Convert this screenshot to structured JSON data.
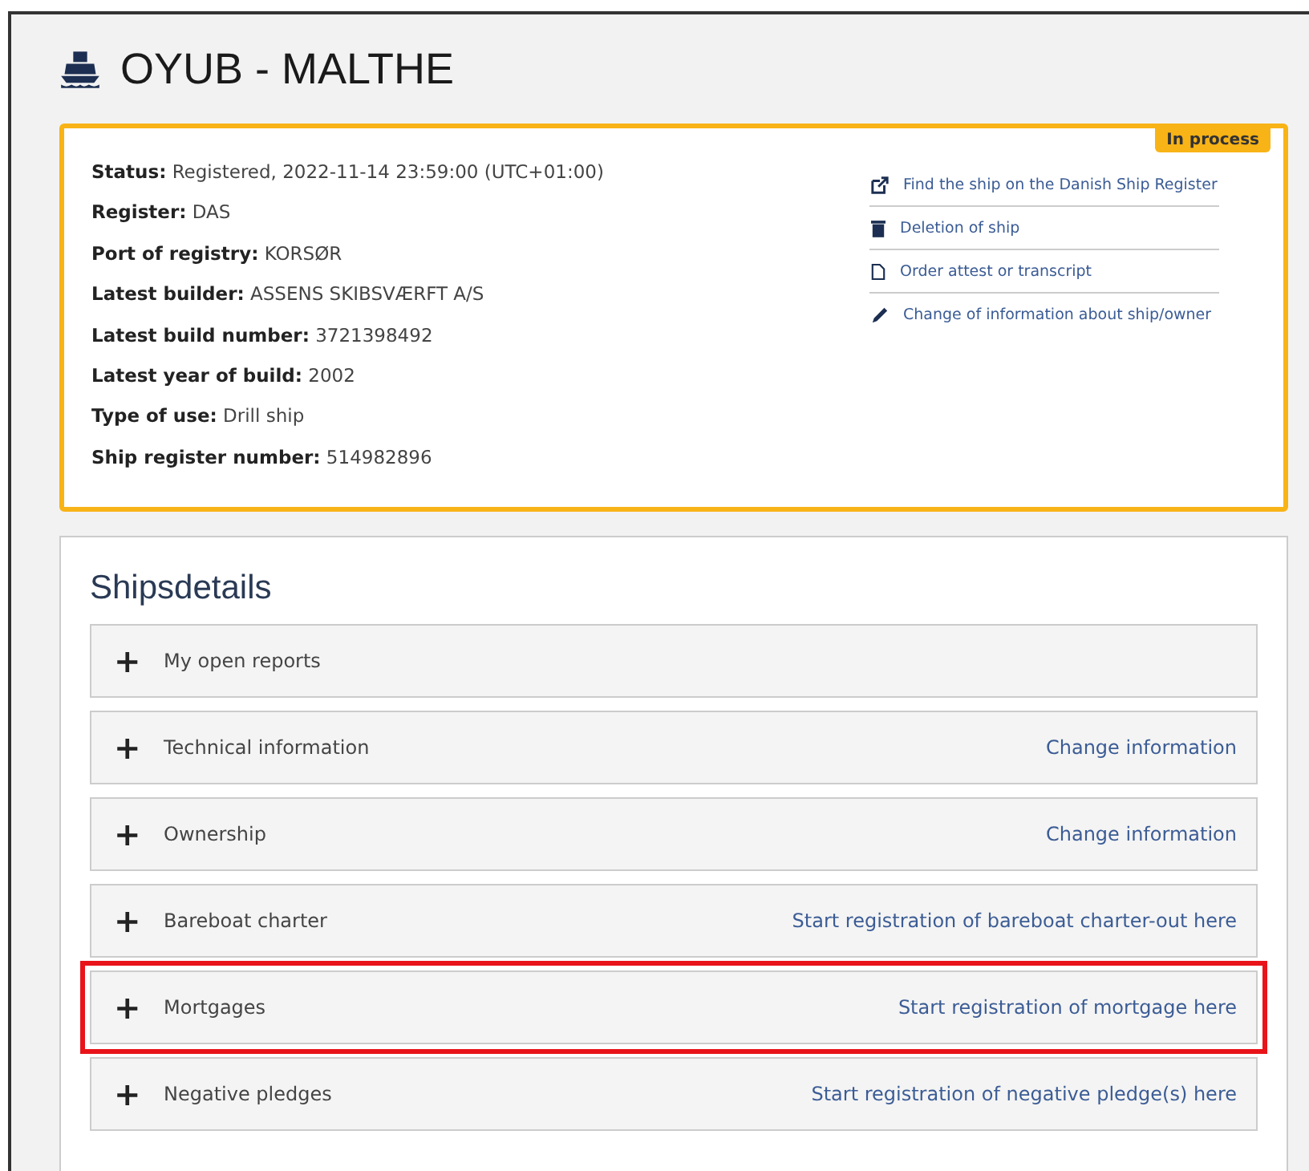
{
  "page": {
    "title": "OYUB - MALTHE"
  },
  "summary": {
    "badge": "In process",
    "fields": [
      {
        "label": "Status:",
        "value": "Registered, 2022-11-14 23:59:00 (UTC+01:00)"
      },
      {
        "label": "Register:",
        "value": "DAS"
      },
      {
        "label": "Port of registry:",
        "value": "KORSØR"
      },
      {
        "label": "Latest builder:",
        "value": "ASSENS SKIBSVÆRFT A/S"
      },
      {
        "label": "Latest build number:",
        "value": "3721398492"
      },
      {
        "label": "Latest year of build:",
        "value": "2002"
      },
      {
        "label": "Type of use:",
        "value": "Drill ship"
      },
      {
        "label": "Ship register number:",
        "value": "514982896"
      }
    ],
    "links": [
      {
        "kind": "external",
        "label": "Find the ship on the Danish Ship Register"
      },
      {
        "kind": "trash",
        "label": "Deletion of ship"
      },
      {
        "kind": "file",
        "label": "Order attest or transcript"
      },
      {
        "kind": "pencil",
        "label": "Change of information about ship/owner"
      }
    ]
  },
  "details": {
    "title": "Shipsdetails",
    "sections": [
      {
        "toggle": "+",
        "label": "My open reports",
        "expanded": false,
        "highlighted": false
      },
      {
        "toggle": "+",
        "label": "Technical information",
        "action": "Change information",
        "expanded": false,
        "highlighted": false
      },
      {
        "toggle": "+",
        "label": "Ownership",
        "action": "Change information",
        "expanded": false,
        "highlighted": false
      },
      {
        "toggle": "+",
        "label": "Bareboat charter",
        "action": "Start registration of bareboat charter-out here",
        "expanded": false,
        "highlighted": false
      },
      {
        "toggle": "+",
        "label": "Mortgages",
        "action": "Start registration of mortgage here",
        "expanded": false,
        "highlighted": true
      },
      {
        "toggle": "+",
        "label": "Negative pledges",
        "action": "Start registration of negative pledge(s) here",
        "expanded": false,
        "highlighted": false
      }
    ]
  }
}
